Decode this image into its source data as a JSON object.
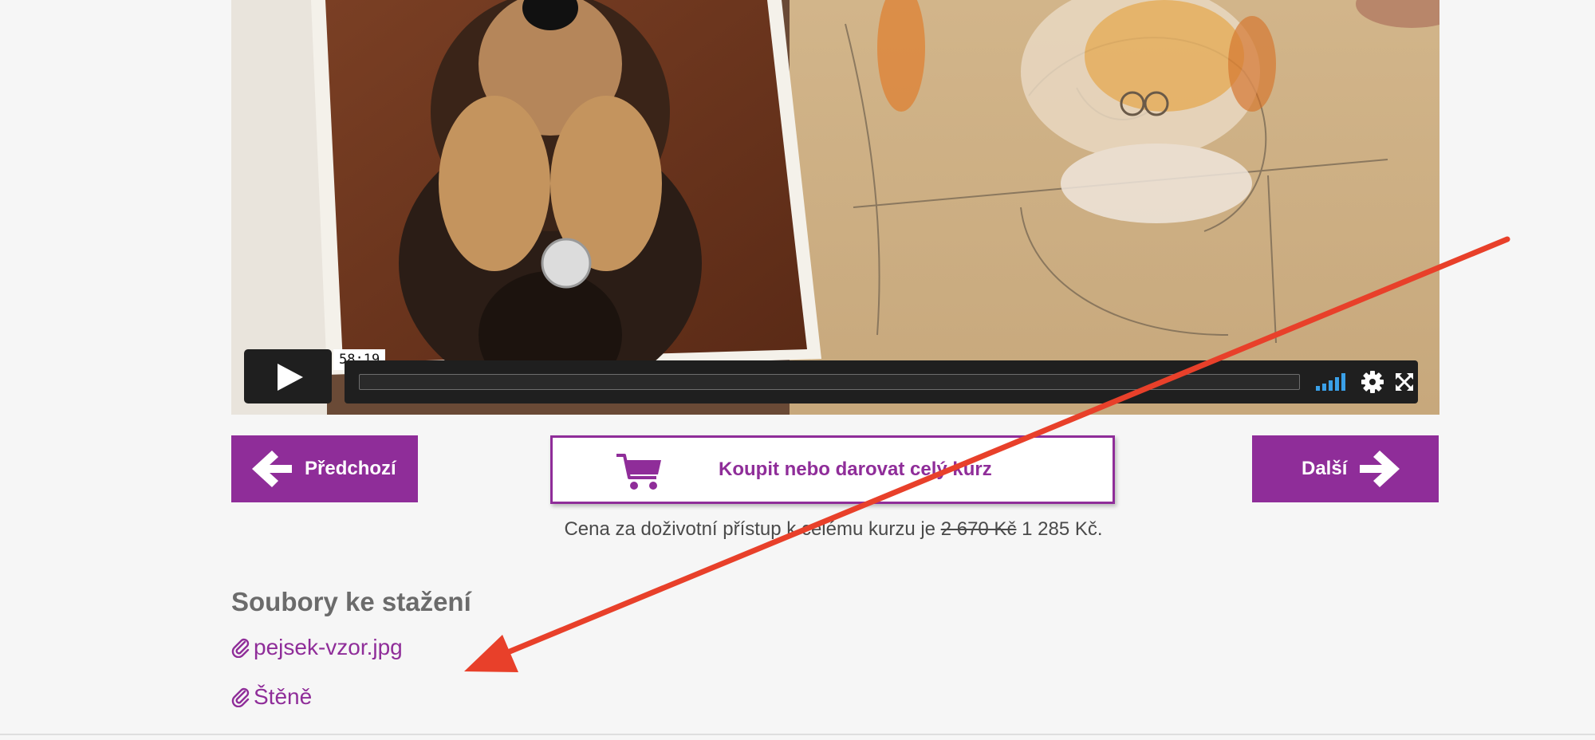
{
  "video": {
    "timestamp": "58:19",
    "progress": 0.0,
    "icons": [
      "play-icon",
      "volume-icon",
      "settings-icon",
      "fullscreen-icon"
    ]
  },
  "navigation": {
    "prev_label": "Předchozí",
    "next_label": "Další",
    "buy_label": "Koupit nebo darovat celý kurz"
  },
  "price": {
    "prefix": "Cena za doživotní přístup k celému kurzu je",
    "old_price": "2 670 Kč",
    "new_price": "1 285 Kč."
  },
  "downloads": {
    "title": "Soubory ke stažení",
    "files": [
      {
        "name": "pejsek-vzor.jpg"
      },
      {
        "name": "Štěně"
      }
    ]
  },
  "colors": {
    "accent": "#8f2d99",
    "annotation_arrow": "#e8402a",
    "volume_blue": "#3aa0e8"
  }
}
